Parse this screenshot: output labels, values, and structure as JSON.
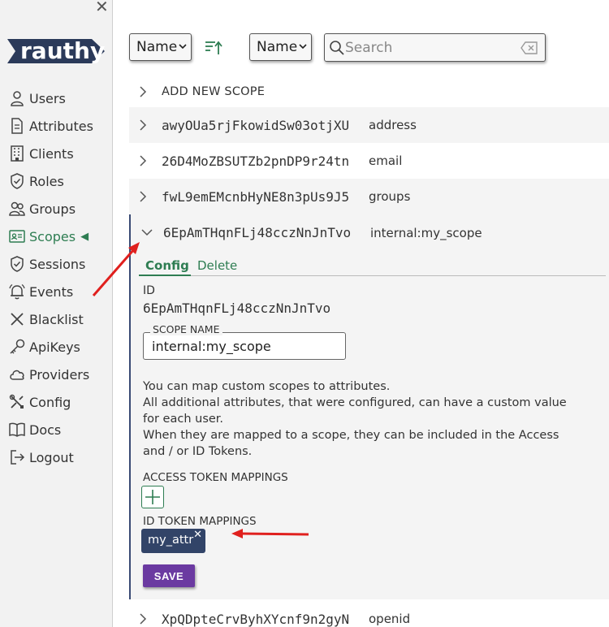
{
  "sidebar": {
    "logo_text": "rauthy",
    "items": [
      {
        "label": "Users",
        "icon": "user-icon"
      },
      {
        "label": "Attributes",
        "icon": "document-icon"
      },
      {
        "label": "Clients",
        "icon": "building-icon"
      },
      {
        "label": "Roles",
        "icon": "shield-check-icon"
      },
      {
        "label": "Groups",
        "icon": "users-icon"
      },
      {
        "label": "Scopes",
        "icon": "id-card-icon",
        "active": true
      },
      {
        "label": "Sessions",
        "icon": "shield-check-icon"
      },
      {
        "label": "Events",
        "icon": "bell-icon"
      },
      {
        "label": "Blacklist",
        "icon": "x-icon"
      },
      {
        "label": "ApiKeys",
        "icon": "key-icon"
      },
      {
        "label": "Providers",
        "icon": "cloud-icon"
      },
      {
        "label": "Config",
        "icon": "tools-icon"
      },
      {
        "label": "Docs",
        "icon": "book-icon"
      },
      {
        "label": "Logout",
        "icon": "logout-icon"
      }
    ]
  },
  "toolbar": {
    "order_select": "Name",
    "search_select": "Name",
    "search_placeholder": "Search"
  },
  "add_new_label": "ADD NEW SCOPE",
  "scopes": [
    {
      "id": "awyOUa5rjFkowidSw03otjXU",
      "name": "address"
    },
    {
      "id": "26D4MoZBSUTZb2pnDP9r24tn",
      "name": "email"
    },
    {
      "id": "fwL9emEMcnbHyNE8n3pUs9J5",
      "name": "groups"
    }
  ],
  "expanded": {
    "id": "6EpAmTHqnFLj48cczNnJnTvo",
    "name": "internal:my_scope",
    "tab_config": "Config",
    "tab_delete": "Delete",
    "id_label": "ID",
    "scope_name_label": "SCOPE NAME",
    "scope_name_value": "internal:my_scope",
    "desc_line1": "You can map custom scopes to attributes.",
    "desc_line2": "All additional attributes, that were configured, can have a custom value for each user.",
    "desc_line3": "When they are mapped to a scope, they can be included in the Access and / or ID Tokens.",
    "access_label": "ACCESS TOKEN MAPPINGS",
    "id_token_label": "ID TOKEN MAPPINGS",
    "chip": "my_attr",
    "save": "SAVE"
  },
  "last_scope": {
    "id": "XpQDpteCrvByhXYcnf9n2gyN",
    "name": "openid"
  },
  "colors": {
    "accent_green": "#2e7d52",
    "chip_bg": "#324468",
    "save_bg": "#6b3aa1",
    "arrow": "#e0201e"
  }
}
